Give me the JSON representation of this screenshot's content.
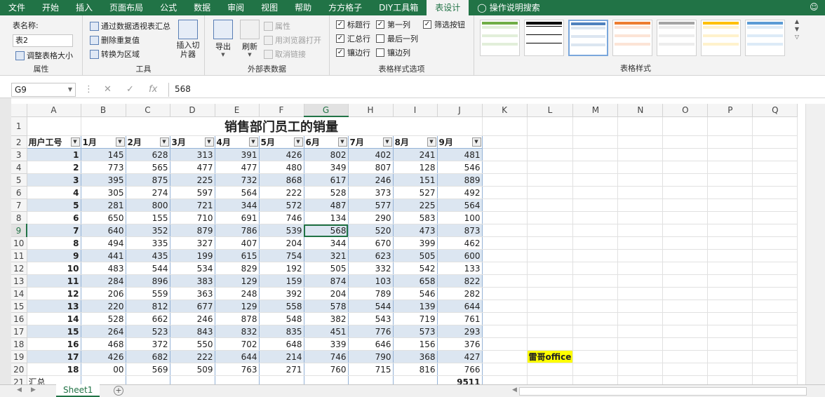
{
  "menu": {
    "tabs": [
      "文件",
      "开始",
      "插入",
      "页面布局",
      "公式",
      "数据",
      "审阅",
      "视图",
      "帮助",
      "方方格子",
      "DIY工具箱",
      "表设计"
    ],
    "active": "表设计",
    "tell_me": "操作说明搜索"
  },
  "ribbon": {
    "properties": {
      "table_name_label": "表名称:",
      "table_name_value": "表2",
      "resize": "调整表格大小",
      "group": "属性"
    },
    "tools": {
      "pivot": "通过数据透视表汇总",
      "remove_dup": "删除重复值",
      "to_range": "转换为区域",
      "slicer": "插入切片器",
      "group": "工具"
    },
    "external": {
      "export": "导出",
      "refresh": "刷新",
      "properties": "属性",
      "open_browser": "用浏览器打开",
      "unlink": "取消链接",
      "group": "外部表数据"
    },
    "style_options": {
      "header_row": "标题行",
      "total_row": "汇总行",
      "banded_rows": "镶边行",
      "first_col": "第一列",
      "last_col": "最后一列",
      "banded_cols": "镶边列",
      "filter_btn": "筛选按钮",
      "group": "表格样式选项"
    },
    "styles": {
      "group": "表格样式"
    }
  },
  "formula_bar": {
    "cell": "G9",
    "value": "568"
  },
  "sheet": {
    "col_headers": [
      "A",
      "B",
      "C",
      "D",
      "E",
      "F",
      "G",
      "H",
      "I",
      "J",
      "K",
      "L",
      "M",
      "N",
      "O",
      "P",
      "Q"
    ],
    "title": "销售部门员工的销量",
    "headers": [
      "用户工号",
      "1月",
      "2月",
      "3月",
      "4月",
      "5月",
      "6月",
      "7月",
      "8月",
      "9月"
    ],
    "rows": [
      [
        1,
        145,
        628,
        313,
        391,
        426,
        802,
        402,
        241,
        481
      ],
      [
        2,
        773,
        565,
        477,
        477,
        480,
        349,
        807,
        128,
        546
      ],
      [
        3,
        395,
        875,
        225,
        732,
        868,
        617,
        246,
        151,
        889
      ],
      [
        4,
        305,
        274,
        597,
        564,
        222,
        528,
        373,
        527,
        492
      ],
      [
        5,
        281,
        800,
        721,
        344,
        572,
        487,
        577,
        225,
        564
      ],
      [
        6,
        650,
        155,
        710,
        691,
        746,
        134,
        290,
        583,
        100
      ],
      [
        7,
        640,
        352,
        879,
        786,
        539,
        568,
        520,
        473,
        873
      ],
      [
        8,
        494,
        335,
        327,
        407,
        204,
        344,
        670,
        399,
        462
      ],
      [
        9,
        441,
        435,
        199,
        615,
        754,
        321,
        623,
        505,
        600
      ],
      [
        10,
        483,
        544,
        534,
        829,
        192,
        505,
        332,
        542,
        133
      ],
      [
        11,
        284,
        896,
        383,
        129,
        159,
        874,
        103,
        658,
        822
      ],
      [
        12,
        206,
        559,
        363,
        248,
        392,
        204,
        789,
        546,
        282
      ],
      [
        13,
        220,
        812,
        677,
        129,
        558,
        578,
        544,
        139,
        644
      ],
      [
        14,
        528,
        662,
        246,
        878,
        548,
        382,
        543,
        719,
        761
      ],
      [
        15,
        264,
        523,
        843,
        832,
        835,
        451,
        776,
        573,
        293
      ],
      [
        16,
        468,
        372,
        550,
        702,
        648,
        339,
        646,
        156,
        376
      ],
      [
        17,
        426,
        682,
        222,
        644,
        214,
        746,
        790,
        368,
        427
      ],
      [
        18,
        "00",
        569,
        509,
        763,
        271,
        760,
        715,
        816,
        766
      ]
    ],
    "total_label": "汇总",
    "total_value": "9511",
    "note": "雷哥office",
    "tab_name": "Sheet1"
  },
  "colors": {
    "accent": "#217346",
    "band": "#dce6f1",
    "note_bg": "#ffff00"
  }
}
